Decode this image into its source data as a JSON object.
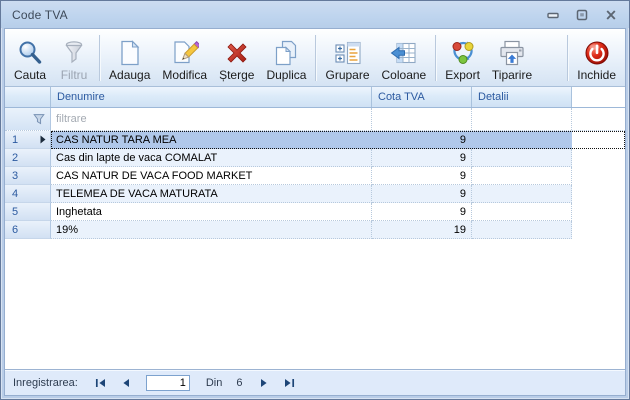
{
  "window": {
    "title": "Code TVA"
  },
  "toolbar": {
    "buttons": [
      {
        "label": "Cauta",
        "icon": "search-icon",
        "disabled": false
      },
      {
        "label": "Filtru",
        "icon": "filter-icon",
        "disabled": true
      },
      {
        "label": "Adauga",
        "icon": "add-page-icon",
        "disabled": false
      },
      {
        "label": "Modifica",
        "icon": "edit-page-icon",
        "disabled": false
      },
      {
        "label": "Șterge",
        "icon": "delete-x-icon",
        "disabled": false
      },
      {
        "label": "Duplica",
        "icon": "duplicate-pages-icon",
        "disabled": false
      },
      {
        "label": "Grupare",
        "icon": "grouping-icon",
        "disabled": false
      },
      {
        "label": "Coloane",
        "icon": "columns-icon",
        "disabled": false
      },
      {
        "label": "Export",
        "icon": "export-cycle-icon",
        "disabled": false
      },
      {
        "label": "Tiparire",
        "icon": "printer-icon",
        "disabled": false
      },
      {
        "label": "Inchide",
        "icon": "power-icon",
        "disabled": false
      }
    ]
  },
  "grid": {
    "columns": {
      "denumire": "Denumire",
      "cota": "Cota TVA",
      "detalii": "Detalii"
    },
    "filter_placeholder": "filtrare",
    "rows": [
      {
        "num": "1",
        "denumire": "CAS NATUR TARA MEA",
        "cota": "9",
        "detalii": "",
        "selected": true
      },
      {
        "num": "2",
        "denumire": "Cas din lapte de vaca COMALAT",
        "cota": "9",
        "detalii": "",
        "selected": false
      },
      {
        "num": "3",
        "denumire": "CAS NATUR DE VACA FOOD MARKET",
        "cota": "9",
        "detalii": "",
        "selected": false
      },
      {
        "num": "4",
        "denumire": "TELEMEA DE VACA MATURATA",
        "cota": "9",
        "detalii": "",
        "selected": false
      },
      {
        "num": "5",
        "denumire": "Inghetata",
        "cota": "9",
        "detalii": "",
        "selected": false
      },
      {
        "num": "6",
        "denumire": "19%",
        "cota": "19",
        "detalii": "",
        "selected": false
      }
    ]
  },
  "statusbar": {
    "label": "Inregistrarea:",
    "record_value": "1",
    "of_label": "Din",
    "total": "6"
  },
  "colors": {
    "titlebar": "#bed4ee",
    "selection": "#b0c8ea",
    "alt_row": "#eaf2fc",
    "header_text": "#2c5aa0",
    "danger": "#c13030",
    "power_red": "#c8170b"
  }
}
